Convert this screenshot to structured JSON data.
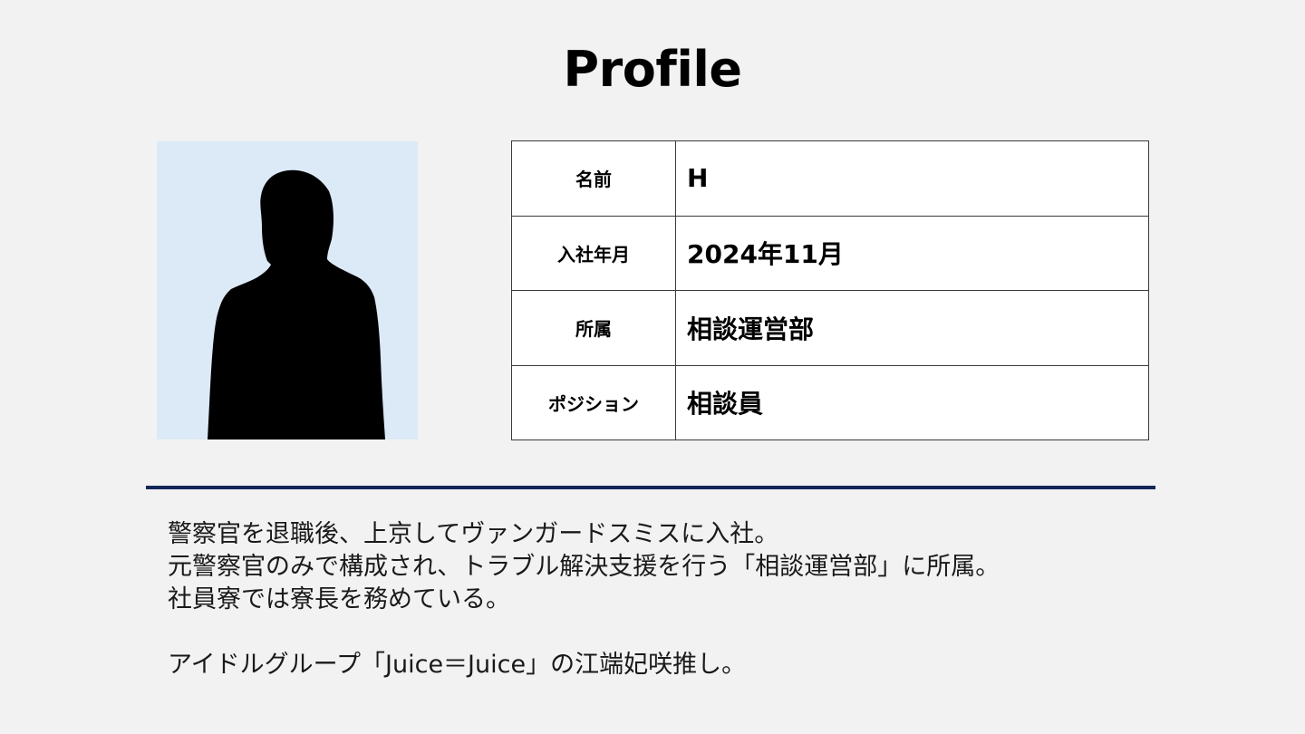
{
  "title": "Profile",
  "photo": {
    "background_color": "#dce9f7",
    "icon": "person-silhouette-icon"
  },
  "profile": {
    "rows": [
      {
        "label": "名前",
        "value": "H"
      },
      {
        "label": "入社年月",
        "value": "2024年11月"
      },
      {
        "label": "所属",
        "value": "相談運営部"
      },
      {
        "label": "ポジション",
        "value": "相談員"
      }
    ]
  },
  "divider_color": "#14275a",
  "description": {
    "lines": [
      "警察官を退職後、上京してヴァンガードスミスに入社。",
      "元警察官のみで構成され、トラブル解決支援を行う「相談運営部」に所属。",
      "社員寮では寮長を務めている。",
      "アイドルグループ「Juice＝Juice」の江端妃咲推し。"
    ]
  }
}
